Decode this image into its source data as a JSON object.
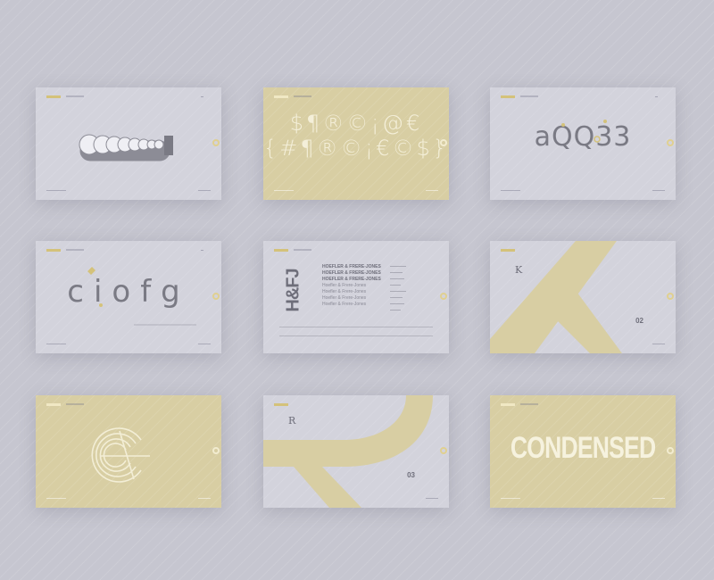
{
  "cards": [
    {
      "id": "blob-glyph",
      "theme": "gray"
    },
    {
      "id": "symbols",
      "theme": "yellow",
      "line1": "$¶®©¡@€",
      "line2": "{#¶®©¡€©$}"
    },
    {
      "id": "aqo33",
      "theme": "gray",
      "text": "aQQ33",
      "prefix": "a"
    },
    {
      "id": "ciofg",
      "theme": "gray",
      "text": "ciofg"
    },
    {
      "id": "hfj",
      "theme": "gray",
      "block": "H&FJ",
      "lines": [
        "HOEFLER & FRERE-JONES",
        "HOEFLER & FRERE-JONES",
        "HOEFLER & FRERE-JONES",
        "Hoefler & Frere-Jones",
        "Hoefler & Frere-Jones",
        "Hoefler & Frere-Jones",
        "Hoefler & Frere-Jones"
      ]
    },
    {
      "id": "big-k",
      "theme": "gray",
      "letter": "K",
      "number": "02",
      "small_glyph": "K"
    },
    {
      "id": "big-c",
      "theme": "yellow",
      "letter": "C"
    },
    {
      "id": "big-r",
      "theme": "gray",
      "letter": "R",
      "number": "03",
      "small_glyph": "R"
    },
    {
      "id": "condensed",
      "theme": "yellow",
      "text": "CONDENSED"
    }
  ],
  "colors": {
    "background": "#c6c6d0",
    "card": "#d3d3dc",
    "accent": "#d4c27a",
    "yellow_card": "#d8cea3",
    "glyph": "#7a7a84"
  }
}
